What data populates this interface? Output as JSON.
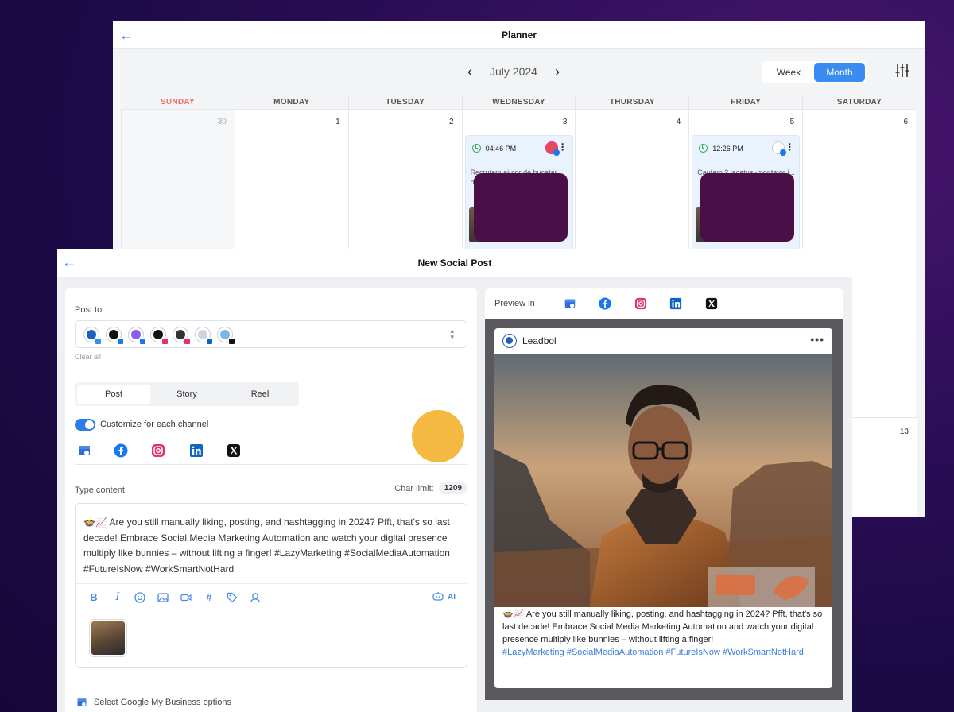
{
  "planner": {
    "title": "Planner",
    "month": "July 2024",
    "views": [
      "Week",
      "Month"
    ],
    "active_view": "Month",
    "days": [
      "SUNDAY",
      "MONDAY",
      "TUESDAY",
      "WEDNESDAY",
      "THURSDAY",
      "FRIDAY",
      "SATURDAY"
    ],
    "dates": [
      "30",
      "1",
      "2",
      "3",
      "4",
      "5",
      "6"
    ],
    "side_date": "13",
    "events": [
      {
        "time": "04:46 PM",
        "snippet": "Recrutam ajutor de bucatar he..."
      },
      {
        "time": "12:26 PM",
        "snippet": "Cautam 2 lacatusi-montator i..."
      }
    ]
  },
  "post": {
    "title": "New Social Post",
    "post_to_label": "Post to",
    "clear_all": "Clear all",
    "types": [
      "Post",
      "Story",
      "Reel"
    ],
    "active_type": "Post",
    "customize_label": "Customize for each channel",
    "customize_on": true,
    "channel_tabs": [
      "google-business",
      "facebook",
      "instagram",
      "linkedin",
      "x"
    ],
    "type_content_label": "Type content",
    "char_limit_label": "Char limit:",
    "char_limit_value": "1209",
    "content": "🍲📈 Are you still manually liking, posting, and hashtagging in 2024? Pfft, that's so last decade! Embrace Social Media Marketing Automation and watch your digital presence multiply like bunnies – without lifting a finger! #LazyMarketing #SocialMediaAutomation #FutureIsNow #WorkSmartNotHard",
    "ai_label": "AI",
    "gmb_label": "Select Google My Business options"
  },
  "preview": {
    "label": "Preview in",
    "account_name": "Leadbol",
    "more": "•••",
    "body": "🍲📈 Are you still manually liking, posting, and hashtagging in 2024? Pfft, that's so last decade! Embrace Social Media Marketing Automation and watch your digital presence multiply like bunnies – without lifting a finger!",
    "tags": "#LazyMarketing #SocialMediaAutomation #FutureIsNow #WorkSmartNotHard"
  },
  "colors": {
    "accent": "#3b8cf0",
    "sunday": "#ee6b6b",
    "avatar_yellow": "#f4b940",
    "hashtag": "#3b7fd8",
    "redaction": "#4a0f47"
  }
}
